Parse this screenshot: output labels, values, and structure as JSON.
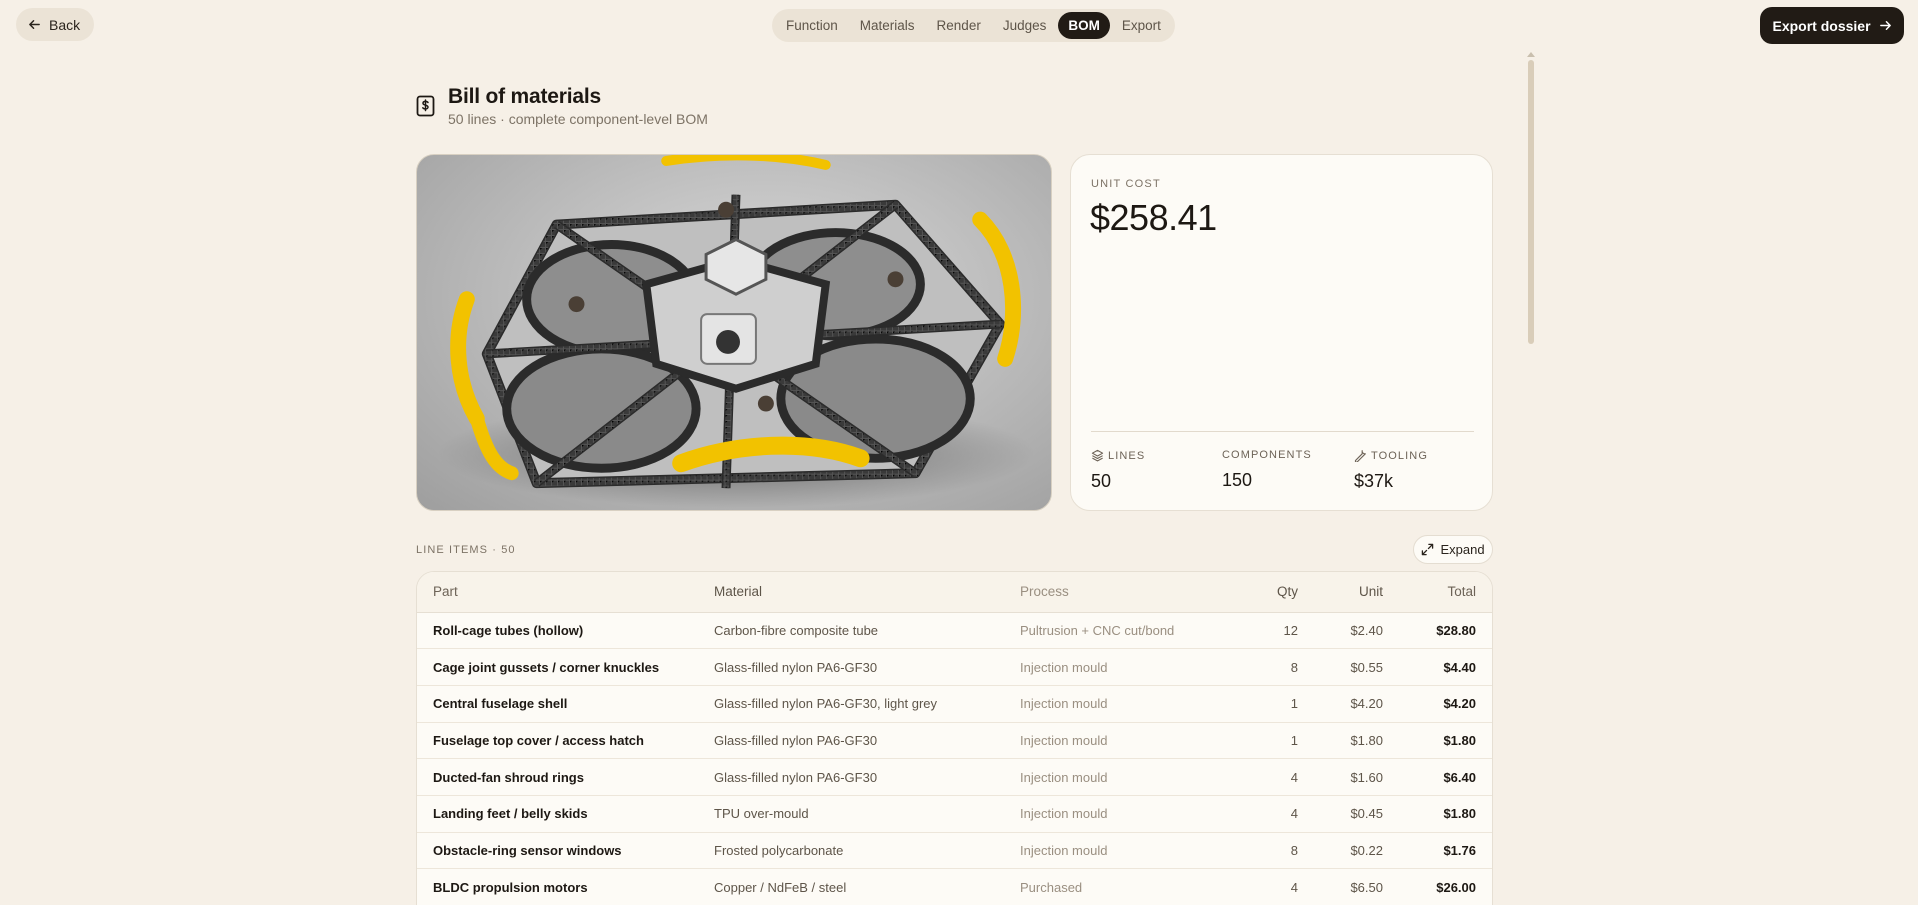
{
  "topbar": {
    "back_label": "Back",
    "tabs": [
      {
        "label": "Function",
        "active": false
      },
      {
        "label": "Materials",
        "active": false
      },
      {
        "label": "Render",
        "active": false
      },
      {
        "label": "Judges",
        "active": false
      },
      {
        "label": "BOM",
        "active": true
      },
      {
        "label": "Export",
        "active": false
      }
    ],
    "export_label": "Export dossier"
  },
  "header": {
    "icon": "dollar-document-icon",
    "title": "Bill of materials",
    "subtitle": "50 lines · complete component-level BOM"
  },
  "cost_card": {
    "unit_cost_label": "UNIT COST",
    "unit_cost_value": "$258.41",
    "stats": [
      {
        "icon": "layers-icon",
        "label": "LINES",
        "value": "50"
      },
      {
        "icon": "",
        "label": "COMPONENTS",
        "value": "150"
      },
      {
        "icon": "wrench-icon",
        "label": "TOOLING",
        "value": "$37k"
      }
    ]
  },
  "line_items": {
    "heading": "LINE ITEMS · 50",
    "expand_label": "Expand",
    "columns": [
      "Part",
      "Material",
      "Process",
      "Qty",
      "Unit",
      "Total"
    ],
    "rows": [
      [
        "Roll-cage tubes (hollow)",
        "Carbon-fibre composite tube",
        "Pultrusion + CNC cut/bond",
        "12",
        "$2.40",
        "$28.80"
      ],
      [
        "Cage joint gussets / corner knuckles",
        "Glass-filled nylon PA6-GF30",
        "Injection mould",
        "8",
        "$0.55",
        "$4.40"
      ],
      [
        "Central fuselage shell",
        "Glass-filled nylon PA6-GF30, light grey",
        "Injection mould",
        "1",
        "$4.20",
        "$4.20"
      ],
      [
        "Fuselage top cover / access hatch",
        "Glass-filled nylon PA6-GF30",
        "Injection mould",
        "1",
        "$1.80",
        "$1.80"
      ],
      [
        "Ducted-fan shroud rings",
        "Glass-filled nylon PA6-GF30",
        "Injection mould",
        "4",
        "$1.60",
        "$6.40"
      ],
      [
        "Landing feet / belly skids",
        "TPU over-mould",
        "Injection mould",
        "4",
        "$0.45",
        "$1.80"
      ],
      [
        "Obstacle-ring sensor windows",
        "Frosted polycarbonate",
        "Injection mould",
        "8",
        "$0.22",
        "$1.76"
      ],
      [
        "BLDC propulsion motors",
        "Copper / NdFeB / steel",
        "Purchased",
        "4",
        "$6.50",
        "$26.00"
      ]
    ]
  },
  "colors": {
    "background": "#f6f0e7",
    "accent_dark": "#211b15",
    "bumper_yellow": "#f2c200"
  }
}
